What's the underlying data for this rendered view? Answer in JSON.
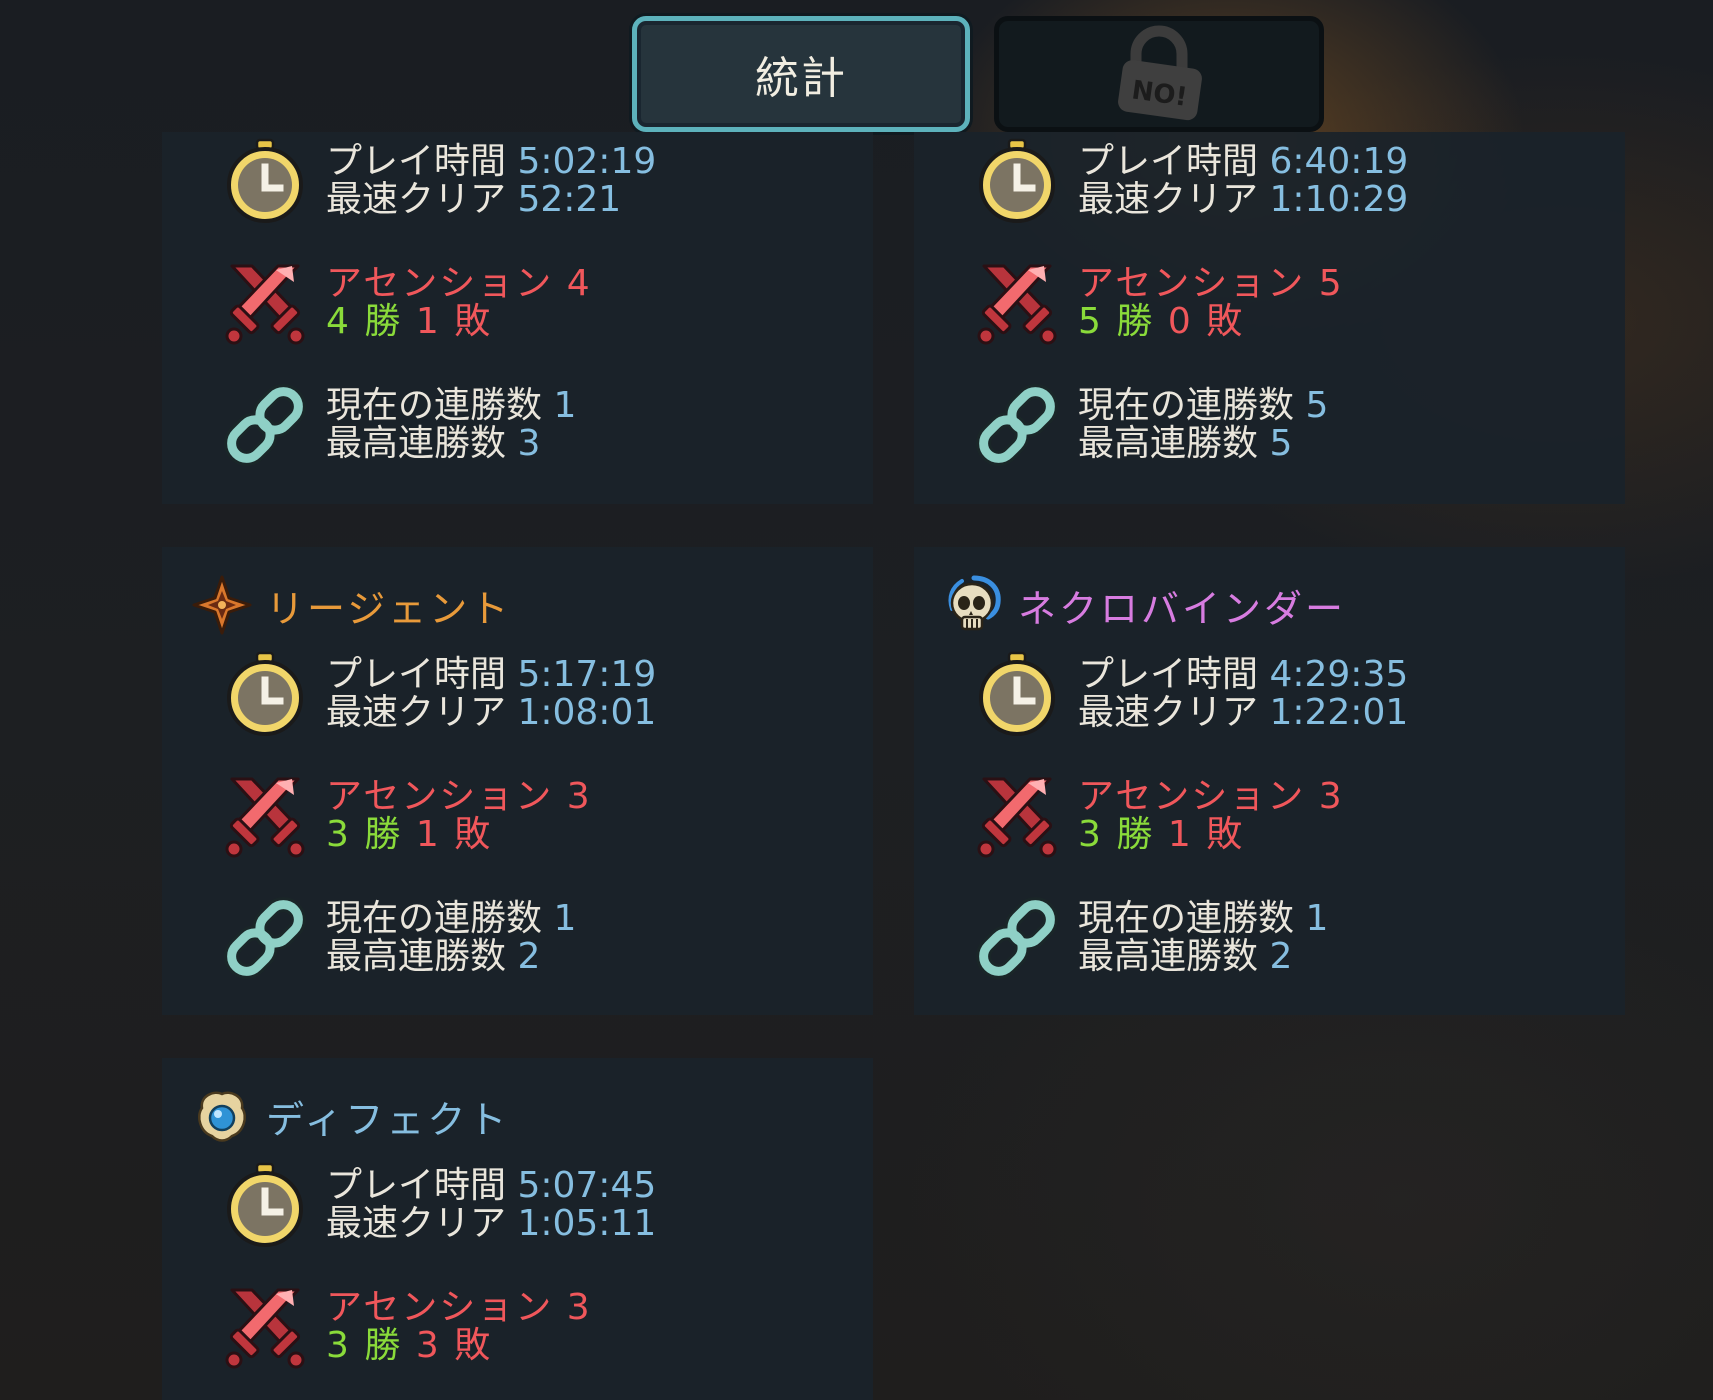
{
  "tabs": {
    "stats_label": "統計",
    "locked_label": "NO!"
  },
  "labels": {
    "playtime": "プレイ時間",
    "fastest": "最速クリア",
    "current_streak": "現在の連勝数",
    "best_streak": "最高連勝数",
    "wins_suffix": "勝",
    "losses_suffix": "敗"
  },
  "characters": [
    {
      "name": "",
      "playtime": "5:02:19",
      "fastest": "52:21",
      "ascension": "アセンション 4",
      "wins": "4",
      "losses": "1",
      "current_streak": "1",
      "best_streak": "3"
    },
    {
      "name": "",
      "playtime": "6:40:19",
      "fastest": "1:10:29",
      "ascension": "アセンション 5",
      "wins": "5",
      "losses": "0",
      "current_streak": "5",
      "best_streak": "5"
    },
    {
      "name": "リージェント",
      "name_color": "#e89a3a",
      "icon": "regent-star-icon",
      "playtime": "5:17:19",
      "fastest": "1:08:01",
      "ascension": "アセンション 3",
      "wins": "3",
      "losses": "1",
      "current_streak": "1",
      "best_streak": "2"
    },
    {
      "name": "ネクロバインダー",
      "name_color": "#d77ce0",
      "icon": "skull-icon",
      "playtime": "4:29:35",
      "fastest": "1:22:01",
      "ascension": "アセンション 3",
      "wins": "3",
      "losses": "1",
      "current_streak": "1",
      "best_streak": "2"
    },
    {
      "name": "ディフェクト",
      "name_color": "#86bee0",
      "icon": "orb-icon",
      "playtime": "5:07:45",
      "fastest": "1:05:11",
      "ascension": "アセンション 3",
      "wins": "3",
      "losses": "3"
    }
  ],
  "colors": {
    "label_white": "#eae6dc",
    "value_blue": "#86bee0",
    "ascension_red": "#f0575b",
    "wins_green": "#8adb3a",
    "tab_border": "#5db2bc"
  },
  "icons": {
    "time": "stopwatch-icon",
    "ascension": "crossed-swords-icon",
    "streak": "chain-link-icon",
    "lock": "padlock-icon"
  }
}
